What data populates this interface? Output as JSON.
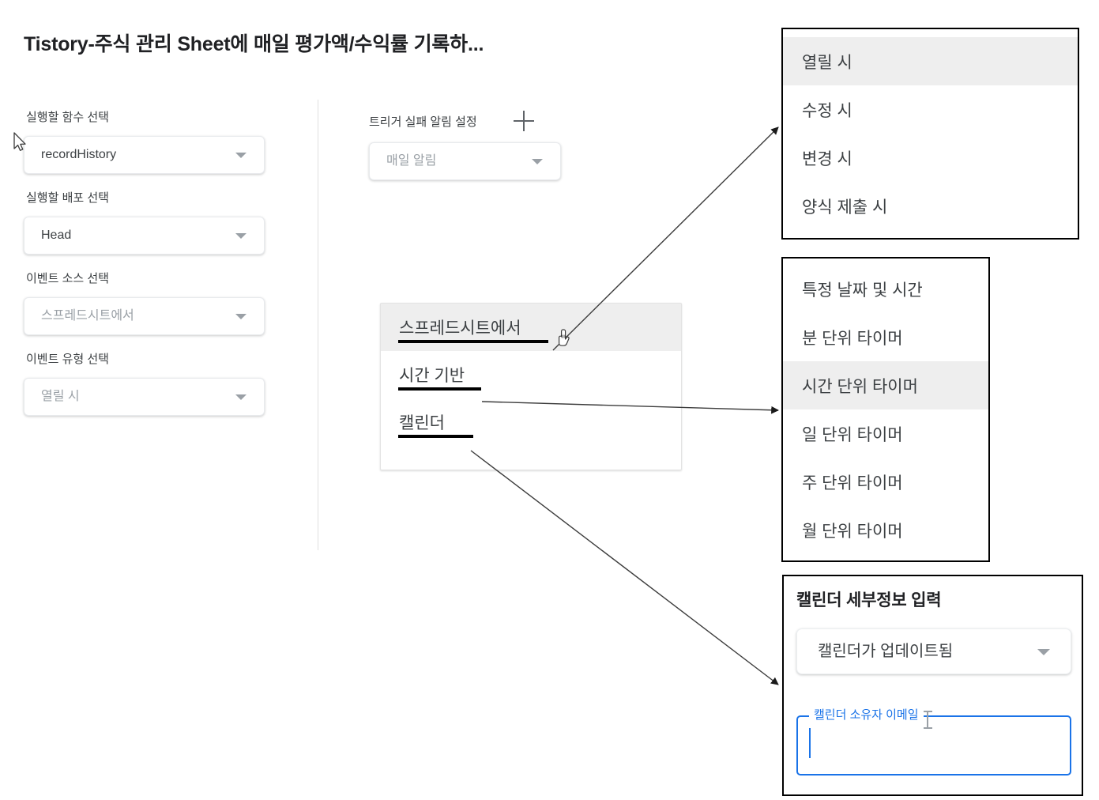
{
  "page": {
    "title": "Tistory-주식 관리 Sheet에 매일 평가액/수익률 기록하...",
    "accent_blue": "#1a73e8",
    "highlight_gray": "#eeeeee"
  },
  "left_form": {
    "fields": [
      {
        "label": "실행할 함수 선택",
        "value": "recordHistory",
        "muted": false,
        "icon": "chevron-down-icon"
      },
      {
        "label": "실행할 배포 선택",
        "value": "Head",
        "muted": false,
        "icon": "chevron-down-icon"
      },
      {
        "label": "이벤트 소스 선택",
        "value": "스프레드시트에서",
        "muted": true,
        "icon": "chevron-down-icon"
      },
      {
        "label": "이벤트 유형 선택",
        "value": "열릴 시",
        "muted": true,
        "icon": "chevron-down-icon"
      }
    ]
  },
  "middle": {
    "title": "트리거 실패 알림 설정",
    "add_icon": "plus-icon",
    "select_value": "매일 알림",
    "select_icon": "chevron-down-icon"
  },
  "source_menu": {
    "items": [
      {
        "label": "스프레드시트에서",
        "highlighted": true
      },
      {
        "label": "시간 기반",
        "highlighted": false
      },
      {
        "label": "캘린더",
        "highlighted": false
      }
    ],
    "cursor": "pointing-hand-cursor"
  },
  "panel_open_types": {
    "items": [
      {
        "label": "열릴 시",
        "highlighted": true
      },
      {
        "label": "수정 시",
        "highlighted": false
      },
      {
        "label": "변경 시",
        "highlighted": false
      },
      {
        "label": "양식 제출 시",
        "highlighted": false
      }
    ]
  },
  "panel_timers": {
    "items": [
      {
        "label": "특정 날짜 및 시간",
        "highlighted": false
      },
      {
        "label": "분 단위 타이머",
        "highlighted": false
      },
      {
        "label": "시간 단위 타이머",
        "highlighted": true
      },
      {
        "label": "일 단위 타이머",
        "highlighted": false
      },
      {
        "label": "주 단위 타이머",
        "highlighted": false
      },
      {
        "label": "월 단위 타이머",
        "highlighted": false
      }
    ]
  },
  "panel_calendar": {
    "title": "캘린더 세부정보 입력",
    "select_value": "캘린더가 업데이트됨",
    "select_icon": "chevron-down-icon",
    "email_label": "캘린더 소유자 이메일",
    "email_value": "",
    "email_focused": true
  },
  "cursors": {
    "arrow_pointer": "arrow-cursor",
    "text_beam": "i-beam-cursor"
  }
}
